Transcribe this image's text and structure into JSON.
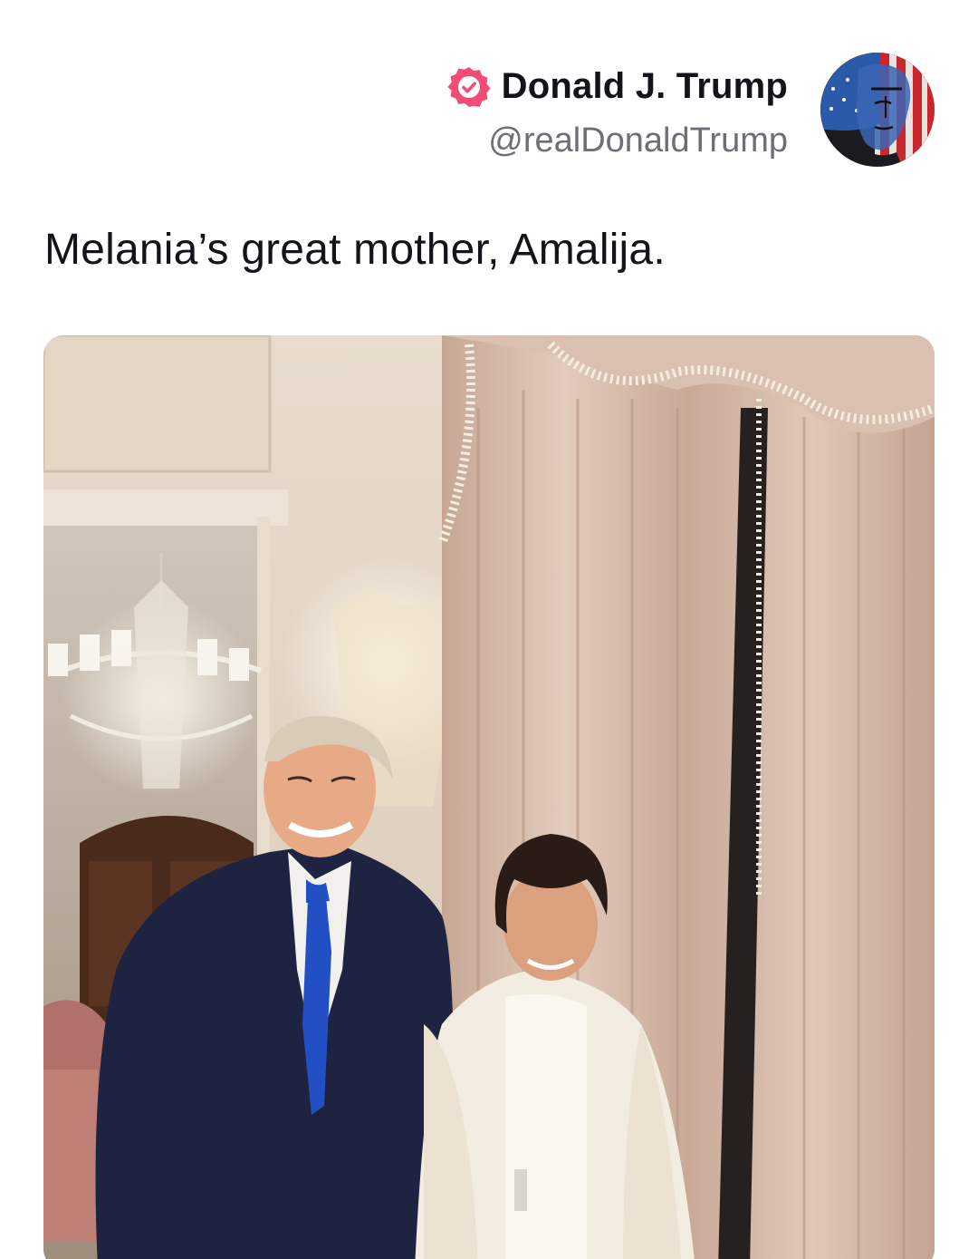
{
  "post": {
    "author": {
      "display_name": "Donald J. Trump",
      "handle": "@realDonaldTrump",
      "verified": true,
      "verified_icon": "verified-badge-icon",
      "avatar_icon": "american-flag-portrait-avatar"
    },
    "text": "Melania’s great mother, Amalija.",
    "media": {
      "type": "photo",
      "content": "two-people-posing-indoors"
    }
  },
  "colors": {
    "verified_badge": "#ef4d77",
    "name_text": "#111418",
    "handle_text": "#6b6f76",
    "background": "#ffffff"
  }
}
